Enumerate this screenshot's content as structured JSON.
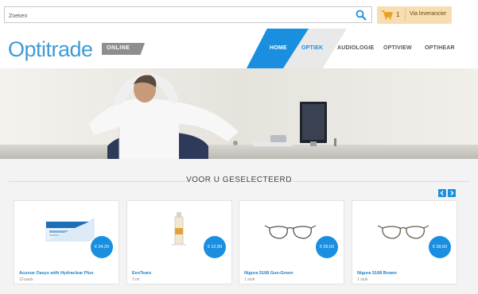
{
  "search": {
    "placeholder": "Zoeken"
  },
  "cart": {
    "count": "1",
    "label": "Via leverancier"
  },
  "brand": {
    "logo": "Optitrade",
    "badge": "ONLINE",
    "accent": "#1a8fe0"
  },
  "nav": {
    "home": "HOME",
    "optiek": "OPTIEK",
    "audiologie": "AUDIOLOGIE",
    "optiview": "OPTIVIEW",
    "optihear": "OPTIHEAR"
  },
  "section": {
    "title": "VOOR U GESELECTEERD"
  },
  "products": [
    {
      "name": "Acuvue Oasys with Hydraclear Plus",
      "sub": "12-pack",
      "price": "€ 34,20",
      "icon": "contact-lens-box-icon"
    },
    {
      "name": "EvoTears",
      "sub": "3 ml",
      "price": "€ 12,99",
      "icon": "eye-drops-icon"
    },
    {
      "name": "Nigura 5168 Gun-Green",
      "sub": "1 stuk",
      "price": "€ 39,50",
      "icon": "glasses-icon"
    },
    {
      "name": "Nigura 5168 Brown",
      "sub": "1 stuk",
      "price": "€ 39,50",
      "icon": "glasses-icon"
    }
  ]
}
